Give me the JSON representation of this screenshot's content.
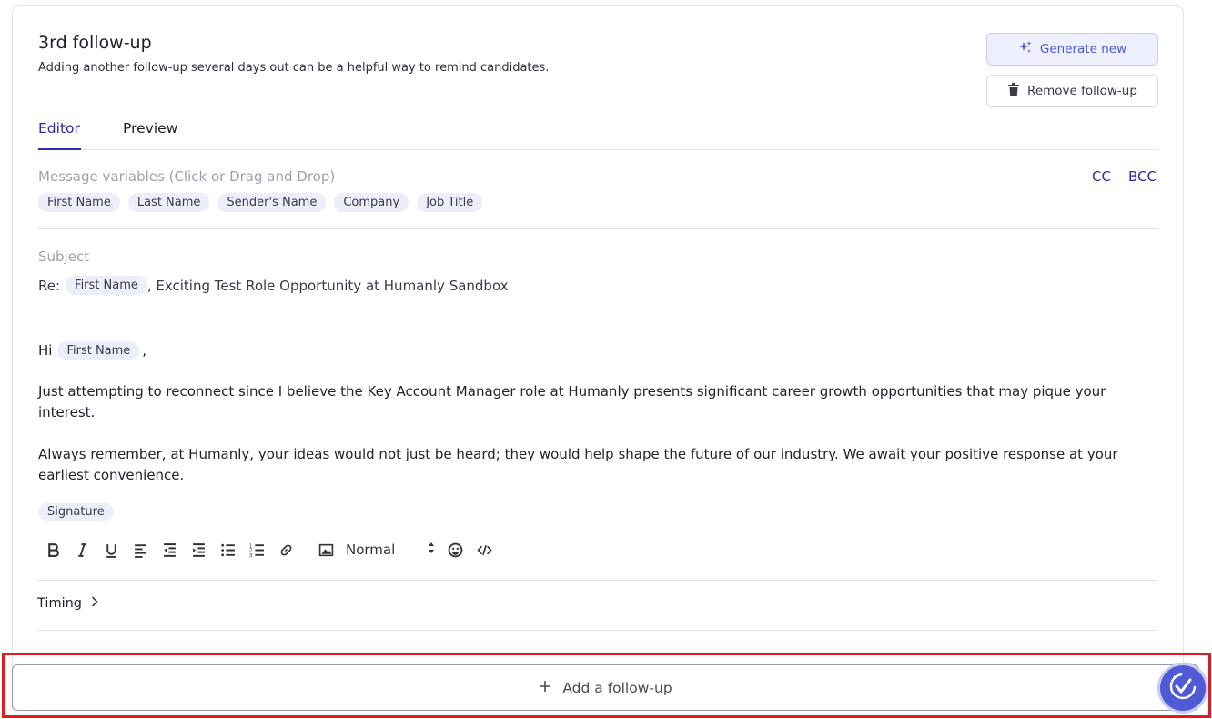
{
  "header": {
    "title": "3rd follow-up",
    "subtitle": "Adding another follow-up several days out can be a helpful way to remind candidates."
  },
  "actions": {
    "generate_label": "Generate new",
    "remove_label": "Remove follow-up"
  },
  "tabs": [
    {
      "label": "Editor",
      "active": true
    },
    {
      "label": "Preview",
      "active": false
    }
  ],
  "variables": {
    "label": "Message variables (Click or Drag and Drop)",
    "chips": [
      "First Name",
      "Last Name",
      "Sender's Name",
      "Company",
      "Job Title"
    ],
    "cc": "CC",
    "bcc": "BCC"
  },
  "subject": {
    "label": "Subject",
    "prefix": "Re:",
    "variable": "First Name",
    "suffix": ", Exciting Test Role Opportunity at Humanly Sandbox"
  },
  "body": {
    "greeting": "Hi",
    "greeting_variable": "First Name",
    "greeting_end": ",",
    "paragraph1": "Just attempting to reconnect since I believe the Key Account Manager role at Humanly presents significant career growth opportunities that may pique your interest.",
    "paragraph2": "Always remember, at Humanly, your ideas would not just be heard; they would help shape the future of our industry. We await your positive response at your earliest convenience.",
    "signature": "Signature"
  },
  "toolbar": {
    "format_value": "Normal",
    "icons": [
      "bold-icon",
      "italic-icon",
      "underline-icon",
      "align-icon",
      "outdent-icon",
      "indent-icon",
      "bullet-list-icon",
      "ordered-list-icon",
      "link-icon",
      "image-icon",
      "emoji-icon",
      "code-icon"
    ]
  },
  "timing": {
    "label": "Timing"
  },
  "footer": {
    "add_label": "Add a follow-up"
  },
  "colors": {
    "accent": "#2c2aa8",
    "generate_bg": "#eef0fd",
    "highlight": "#e11b22",
    "assistant": "#4f5bd5"
  }
}
